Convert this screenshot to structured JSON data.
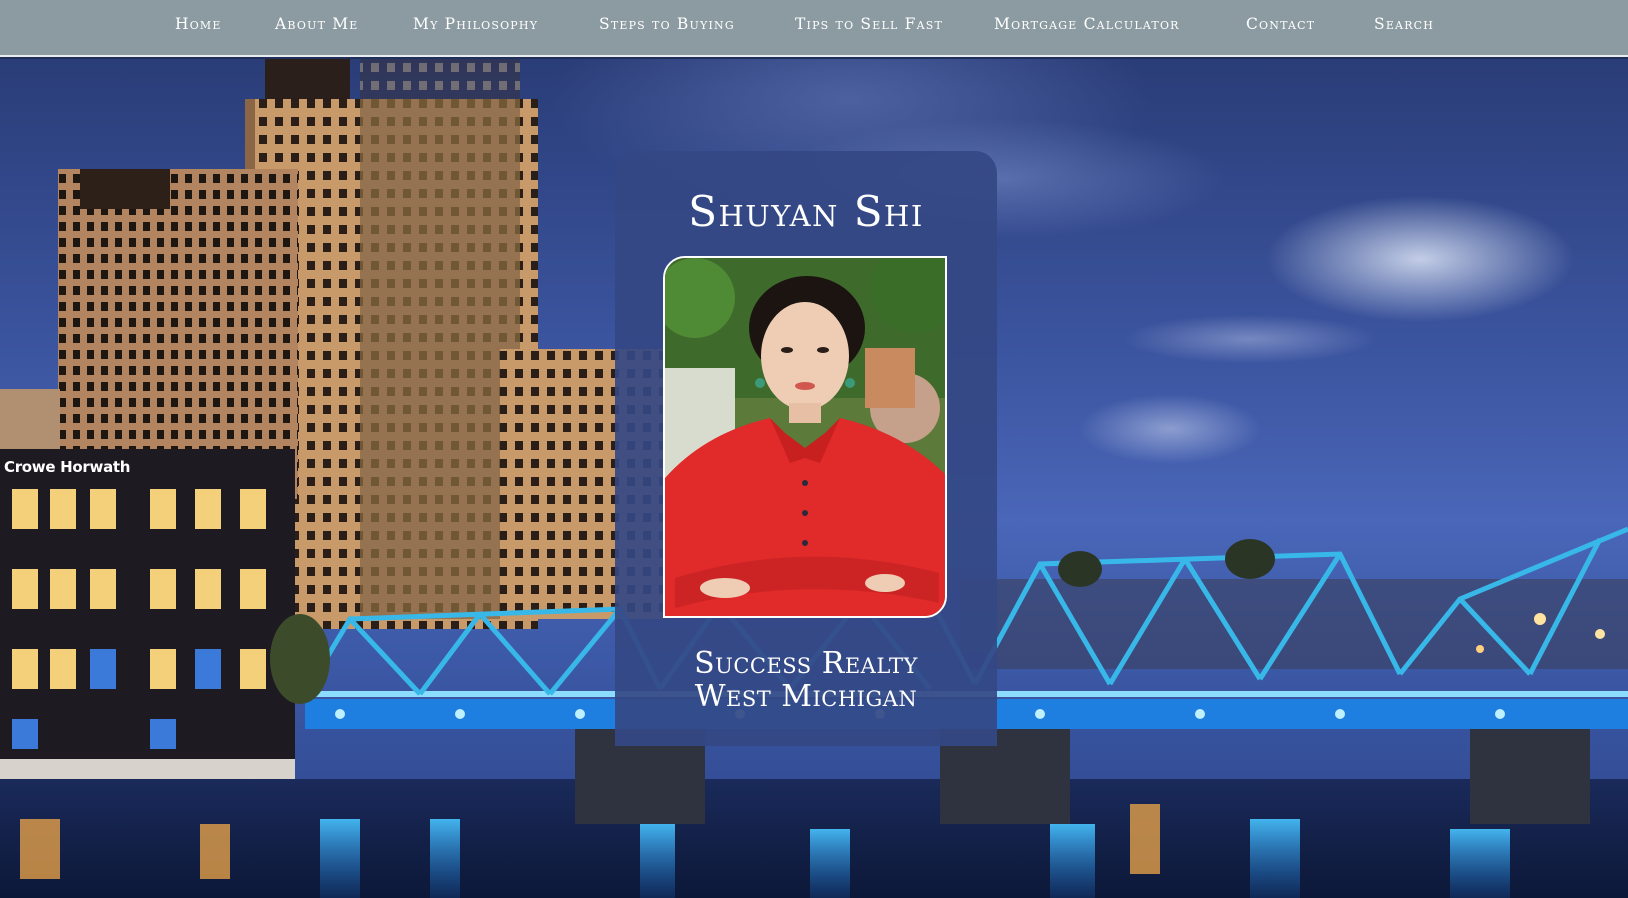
{
  "nav": {
    "items": [
      {
        "label": "Home"
      },
      {
        "label": "About Me"
      },
      {
        "label": "My Philosophy"
      },
      {
        "label": "Steps to Buying"
      },
      {
        "label": "Tips to Sell Fast"
      },
      {
        "label": "Mortgage Calculator"
      },
      {
        "label": "Contact"
      },
      {
        "label": "Search"
      }
    ]
  },
  "hero": {
    "building_sign": "Crowe Horwath"
  },
  "card": {
    "name": "Shuyan Shi",
    "company_line1": "Success Realty",
    "company_line2": "West Michigan"
  },
  "colors": {
    "nav_bg": "#8c9ba2",
    "card_bg": "#34488a",
    "bridge": "#38b8e8",
    "text": "#ffffff"
  }
}
